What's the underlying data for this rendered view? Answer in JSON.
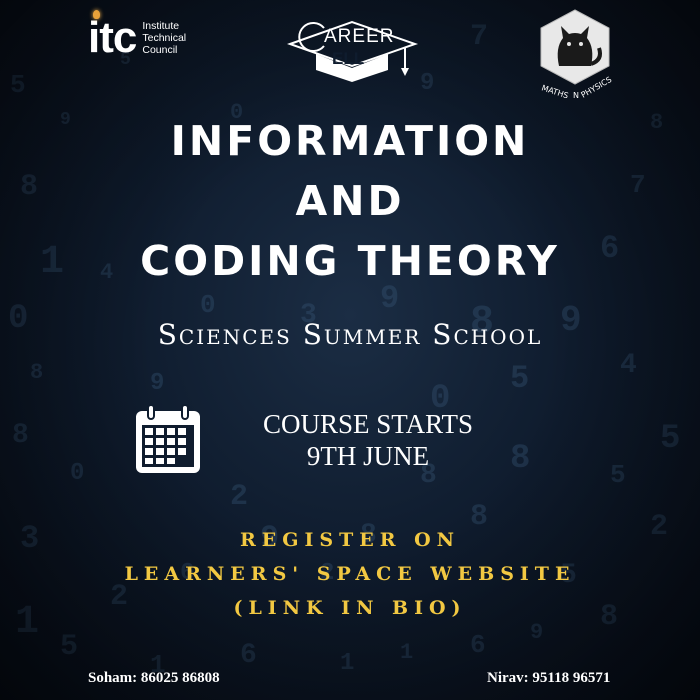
{
  "logos": {
    "itc": {
      "mark": "itc",
      "line1": "Institute",
      "line2": "Technical",
      "line3": "Council"
    },
    "career_cell": {
      "icon": "career-cell-logo",
      "text": "CAREER CELL"
    },
    "maths_n_physics": {
      "icon": "cat-hexagon-logo",
      "text": "MATHS N PHYSICS"
    }
  },
  "title": {
    "line1": "INFORMATION",
    "line2": "AND",
    "line3": "CODING THEORY"
  },
  "subtitle": "Sciences Summer School",
  "course": {
    "icon": "calendar-icon",
    "line1": "COURSE STARTS",
    "line2": "9TH JUNE"
  },
  "register": {
    "line1": "REGISTER ON",
    "line2": "LEARNERS' SPACE WEBSITE",
    "line3": "(LINK IN BIO)"
  },
  "contacts": {
    "left": "Soham: 86025 86808",
    "right": "Nirav: 95118 96571"
  },
  "colors": {
    "background": "#0f1c2e",
    "text": "#ffffff",
    "accent": "#f2c842",
    "bulb": "#e8a13a"
  }
}
